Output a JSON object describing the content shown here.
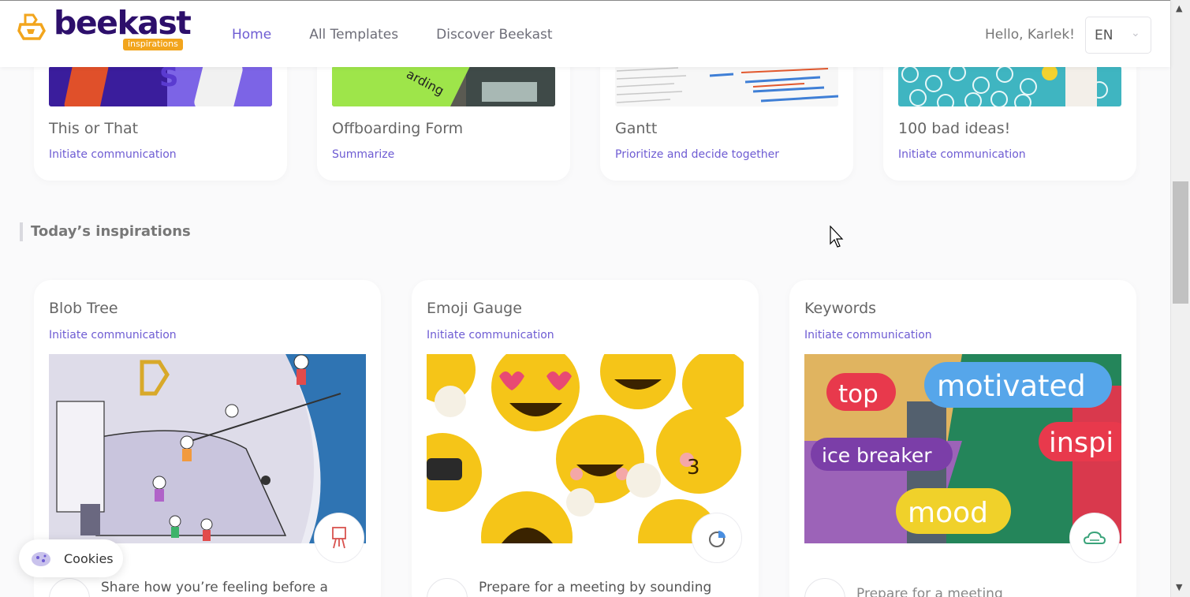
{
  "header": {
    "logo_text": "beekast",
    "logo_subtext": "inspirations",
    "nav": [
      {
        "label": "Home",
        "active": true
      },
      {
        "label": "All Templates",
        "active": false
      },
      {
        "label": "Discover Beekast",
        "active": false
      }
    ],
    "greeting": "Hello, Karlek!",
    "language": "EN"
  },
  "top_cards": [
    {
      "title": "This or That",
      "category": "Initiate communication"
    },
    {
      "title": "Offboarding Form",
      "category": "Summarize"
    },
    {
      "title": "Gantt",
      "category": "Prioritize and decide together"
    },
    {
      "title": "100 bad ideas!",
      "category": "Initiate communication"
    }
  ],
  "section": {
    "title": "Today’s inspirations"
  },
  "inspirations": [
    {
      "title": "Blob Tree",
      "category": "Initiate communication",
      "badge_icon": "easel-icon",
      "description": "Share how you’re feeling before a"
    },
    {
      "title": "Emoji Gauge",
      "category": "Initiate communication",
      "badge_icon": "pie-chart-icon",
      "description": "Prepare for a meeting by sounding out"
    },
    {
      "title": "Keywords",
      "category": "Initiate communication",
      "badge_icon": "word-cloud-icon",
      "description": "Prepare for a meeting"
    }
  ],
  "keywords_image_words": [
    "top",
    "motivated",
    "inspi",
    "ice breaker",
    "mood"
  ],
  "offboarding_image_word": "arding",
  "cookie": {
    "label": "Cookies"
  },
  "colors": {
    "accent": "#6e5cd3",
    "brand_dark": "#2d0f6b",
    "brand_orange": "#f2a51d"
  }
}
